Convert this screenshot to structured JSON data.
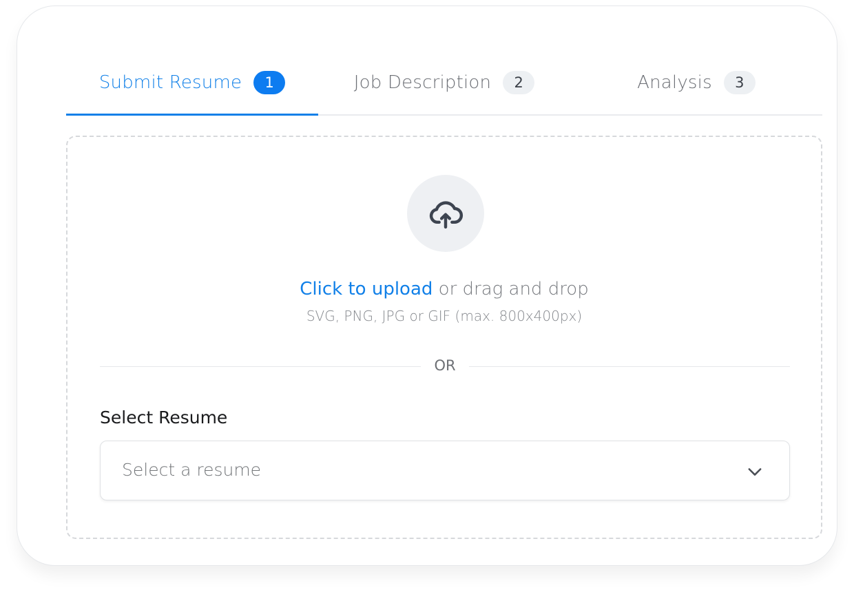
{
  "tabs": [
    {
      "label": "Submit Resume",
      "badge": "1",
      "active": true
    },
    {
      "label": "Job Description",
      "badge": "2",
      "active": false
    },
    {
      "label": "Analysis",
      "badge": "3",
      "active": false
    }
  ],
  "upload": {
    "icon": "cloud-upload-icon",
    "link_text": "Click to upload",
    "rest_text": " or drag and drop",
    "hint": "SVG, PNG, JPG or GIF (max. 800x400px)"
  },
  "divider": {
    "text": "OR"
  },
  "resume_select": {
    "label": "Select Resume",
    "placeholder": "Select a resume",
    "icon": "chevron-down-icon"
  },
  "colors": {
    "accent": "#1180e8",
    "badge_active": "#0d7cf0",
    "badge_inactive": "#edf0f3"
  }
}
